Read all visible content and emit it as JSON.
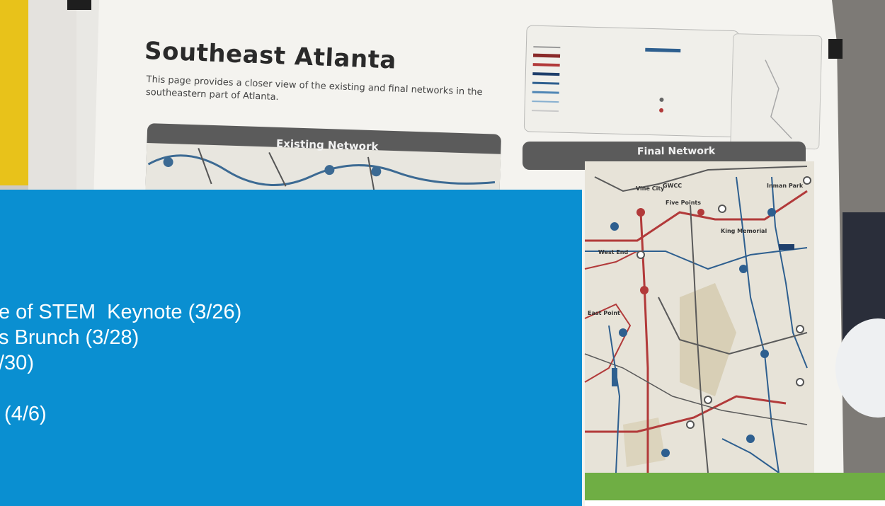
{
  "poster": {
    "title": "Southeast Atlanta",
    "description": "This page provides a closer view of the existing and final networks in the southeastern part of Atlanta.",
    "existing_tab": "Existing Network",
    "final_tab": "Final Network",
    "place_labels": [
      "West End",
      "King Memorial",
      "Five Points",
      "GWCC",
      "Vine City",
      "Inman Park",
      "East Point"
    ]
  },
  "overlay": {
    "lines": [
      "e of STEM  Keynote (3/26)",
      "s Brunch (3/28)",
      "/30)",
      "",
      " (4/6)"
    ]
  },
  "colors": {
    "overlay_blue": "#0a8fd1",
    "accent_green": "#6fae44",
    "accent_yellow": "#e8c21a",
    "route_red": "#b23a3a",
    "route_blue": "#2e5f8f"
  }
}
